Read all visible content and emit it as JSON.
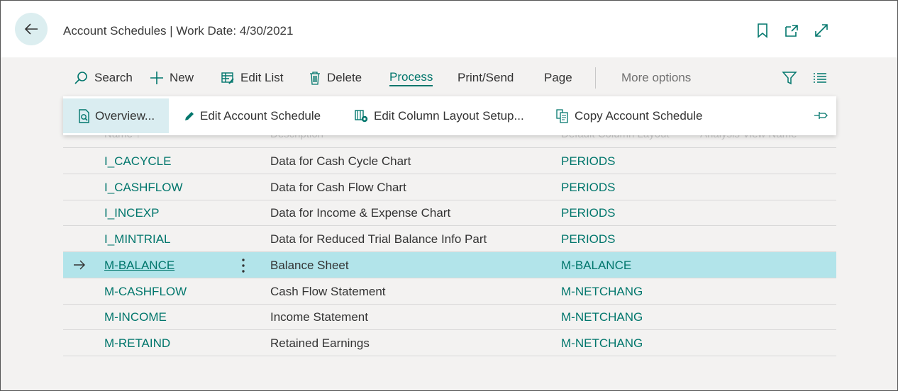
{
  "header": {
    "title": "Account Schedules | Work Date: 4/30/2021",
    "icons": [
      "back-arrow-icon",
      "bookmark-icon",
      "open-new-window-icon",
      "expand-icon"
    ]
  },
  "actions": {
    "search": "Search",
    "new": "New",
    "edit_list": "Edit List",
    "delete": "Delete",
    "process": "Process",
    "print_send": "Print/Send",
    "page": "Page",
    "more_options": "More options"
  },
  "process_menu": {
    "overview": "Overview...",
    "edit_account_schedule": "Edit Account Schedule",
    "edit_column_layout": "Edit Column Layout Setup...",
    "copy_account_schedule": "Copy Account Schedule"
  },
  "columns": {
    "name": "Name ↑",
    "description": "Description",
    "default_column_layout": "Default Column Layout",
    "analysis_view": "Analysis View Name"
  },
  "rows": [
    {
      "name": "I_CACYCLE",
      "description": "Data for Cash Cycle Chart",
      "column_layout": "PERIODS"
    },
    {
      "name": "I_CASHFLOW",
      "description": "Data for Cash Flow Chart",
      "column_layout": "PERIODS"
    },
    {
      "name": "I_INCEXP",
      "description": "Data for Income & Expense Chart",
      "column_layout": "PERIODS"
    },
    {
      "name": "I_MINTRIAL",
      "description": "Data for Reduced Trial Balance Info Part",
      "column_layout": "PERIODS"
    },
    {
      "name": "M-BALANCE",
      "description": "Balance Sheet",
      "column_layout": "M-BALANCE"
    },
    {
      "name": "M-CASHFLOW",
      "description": "Cash Flow Statement",
      "column_layout": "M-NETCHANG"
    },
    {
      "name": "M-INCOME",
      "description": "Income Statement",
      "column_layout": "M-NETCHANG"
    },
    {
      "name": "M-RETAIND",
      "description": "Retained Earnings",
      "column_layout": "M-NETCHANG"
    }
  ],
  "selected_row": "M-BALANCE",
  "colors": {
    "accent": "#00766c",
    "selected_row": "#b2e4ea",
    "back_button": "#dceef0"
  }
}
